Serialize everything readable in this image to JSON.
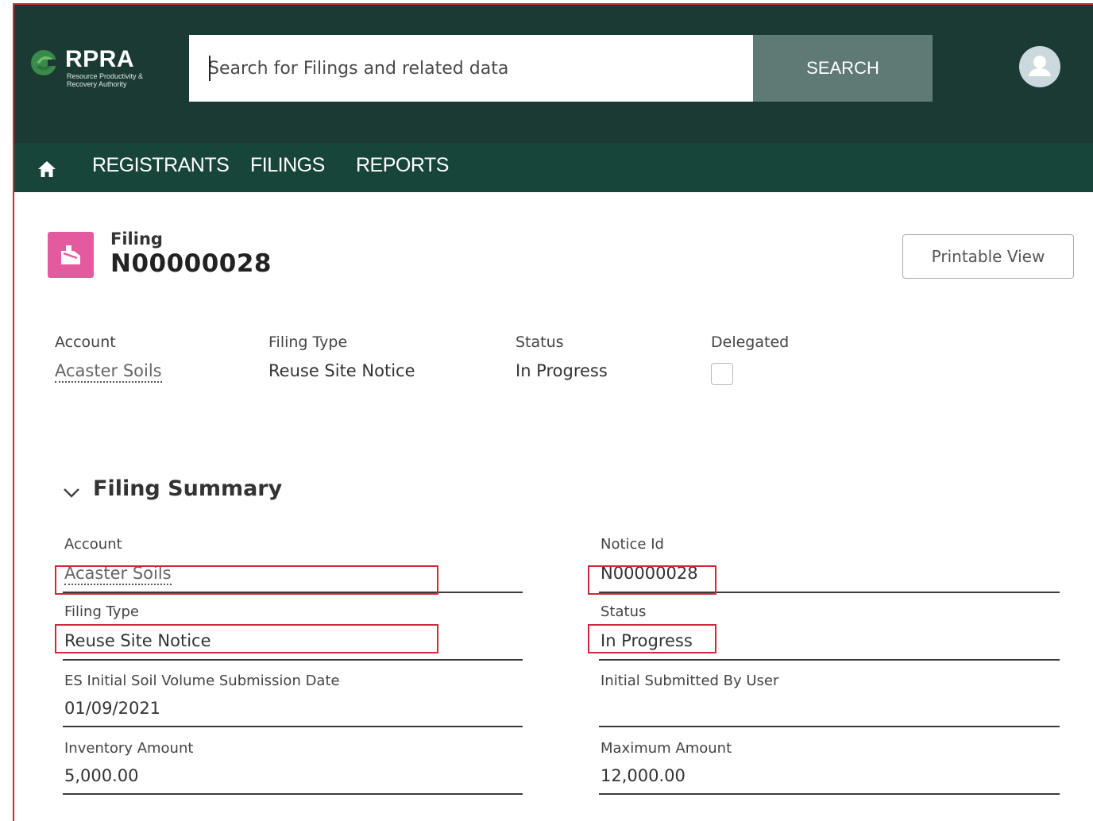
{
  "brand": {
    "name": "RPRA",
    "subtitle": "Resource Productivity & Recovery Authority"
  },
  "search": {
    "placeholder": "Search for Filings and related data",
    "button_label": "SEARCH"
  },
  "nav": {
    "items": [
      {
        "label": "REGISTRANTS"
      },
      {
        "label": "FILINGS"
      },
      {
        "label": "REPORTS"
      }
    ]
  },
  "record": {
    "type_label": "Filing",
    "name": "N00000028",
    "icon": "filing-record-icon",
    "icon_color": "#e35a9f",
    "printable_label": "Printable View"
  },
  "highlights": [
    {
      "label": "Account",
      "value": "Acaster Soils"
    },
    {
      "label": "Filing Type",
      "value": "Reuse Site Notice"
    },
    {
      "label": "Status",
      "value": "In Progress"
    },
    {
      "label": "Delegated",
      "checked": false
    }
  ],
  "summary": {
    "title": "Filing Summary",
    "fields": {
      "account": {
        "label": "Account",
        "value": "Acaster Soils"
      },
      "notice_id": {
        "label": "Notice Id",
        "value": "N00000028"
      },
      "filing_type": {
        "label": "Filing Type",
        "value": "Reuse Site Notice"
      },
      "status": {
        "label": "Status",
        "value": "In Progress"
      },
      "es_date": {
        "label": "ES Initial Soil Volume Submission Date",
        "value": "01/09/2021"
      },
      "initial_user": {
        "label": "Initial Submitted By User",
        "value": ""
      },
      "inventory_amount": {
        "label": "Inventory Amount",
        "value": "5,000.00"
      },
      "maximum_amount": {
        "label": "Maximum Amount",
        "value": "12,000.00"
      }
    }
  },
  "colors": {
    "header": "#1b3a33",
    "nav": "#184539",
    "search_button": "#5f7a74",
    "highlight_box": "#d0283a"
  }
}
